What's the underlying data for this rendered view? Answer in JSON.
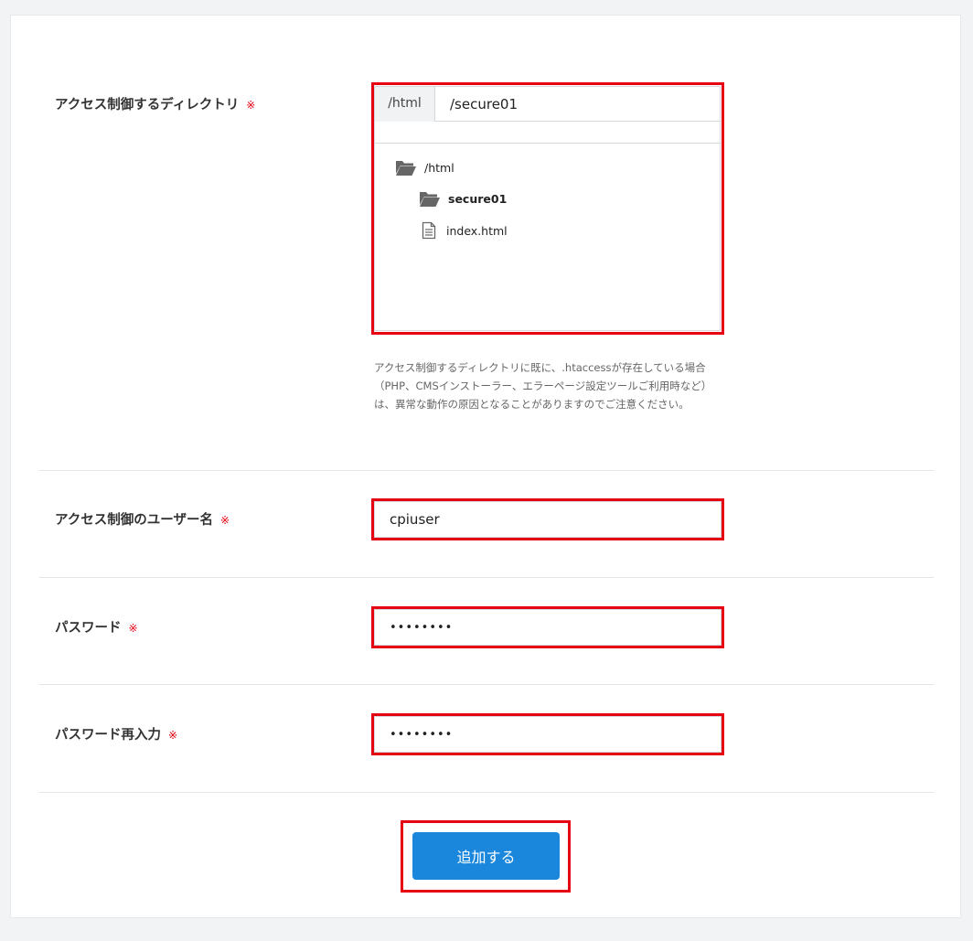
{
  "form": {
    "directory": {
      "label": "アクセス制御するディレクトリ",
      "required_mark": "※",
      "prefix": "/html",
      "value": "/secure01",
      "tree": [
        {
          "name": "/html",
          "type": "folder-open",
          "level": 0,
          "bold": false
        },
        {
          "name": "secure01",
          "type": "folder-open",
          "level": 1,
          "bold": true
        },
        {
          "name": "index.html",
          "type": "file",
          "level": 1,
          "bold": false
        }
      ],
      "note": "アクセス制御するディレクトリに既に、.htaccessが存在している場合（PHP、CMSインストーラー、エラーページ設定ツールご利用時など）は、異常な動作の原因となることがありますのでご注意ください。"
    },
    "username": {
      "label": "アクセス制御のユーザー名",
      "required_mark": "※",
      "value": "cpiuser"
    },
    "password": {
      "label": "パスワード",
      "required_mark": "※",
      "value": "••••••••"
    },
    "password_confirm": {
      "label": "パスワード再入力",
      "required_mark": "※",
      "value": "••••••••"
    },
    "submit_label": "追加する"
  },
  "colors": {
    "highlight": "#e60012",
    "required": "#e60012",
    "primary_button": "#1a87dc",
    "folder_icon": "#666666"
  },
  "icons": {
    "folder": "folder-open-icon",
    "file": "file-icon"
  }
}
